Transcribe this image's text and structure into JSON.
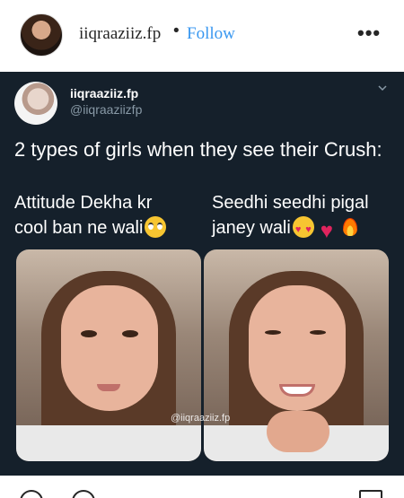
{
  "post_header": {
    "username": "iiqraaziiz.fp",
    "separator": "•",
    "follow_label": "Follow",
    "more_label": "•••"
  },
  "tweet": {
    "display_name": "iiqraaziiz.fp",
    "handle": "@iiqraaziizfp",
    "text": "2 types of girls when they see their Crush:",
    "left_caption": [
      "Attitude Dekha kr",
      "cool ban ne wali"
    ],
    "right_caption": [
      "Seedhi seedhi pigal",
      "janey wali"
    ],
    "watermark": "@iiqraaziiz.fp",
    "icons": [
      "chevron-down-icon",
      "face-rolling-eyes-icon",
      "heart-eyes-icon",
      "heart-icon",
      "fire-icon"
    ]
  },
  "actions": {
    "icons": [
      "heart-icon",
      "comment-icon",
      "bookmark-icon"
    ]
  }
}
